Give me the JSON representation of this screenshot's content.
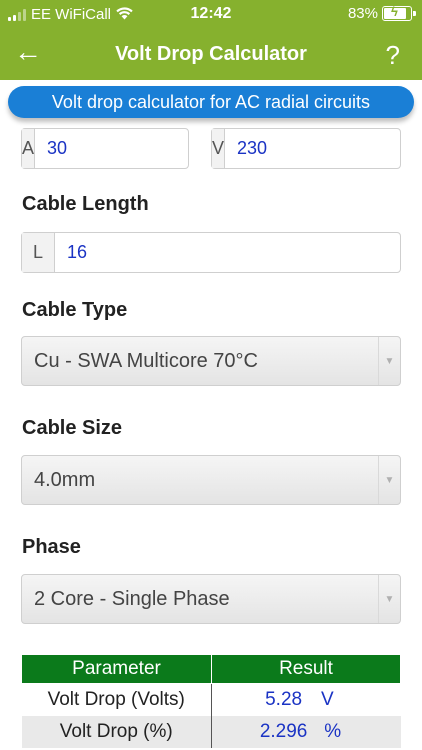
{
  "status": {
    "carrier": "EE WiFiCall",
    "time": "12:42",
    "battery_percent": "83%",
    "battery_level": 0.83
  },
  "nav": {
    "back_icon": "←",
    "title": "Volt Drop Calculator",
    "help_icon": "?"
  },
  "banner": "Volt drop calculator for AC radial circuits",
  "inputs": {
    "current": {
      "addon": "A",
      "value": "30"
    },
    "voltage": {
      "addon": "V",
      "value": "230"
    },
    "length": {
      "addon": "L",
      "value": "16"
    }
  },
  "labels": {
    "cable_length": "Cable Length",
    "cable_type": "Cable Type",
    "cable_size": "Cable Size",
    "phase": "Phase"
  },
  "selects": {
    "cable_type": "Cu - SWA Multicore 70°C",
    "cable_size": "4.0mm",
    "phase": "2 Core - Single Phase"
  },
  "results": {
    "headers": [
      "Parameter",
      "Result"
    ],
    "rows": [
      {
        "parameter": "Volt Drop (Volts)",
        "value": "5.28",
        "unit": "V"
      },
      {
        "parameter": "Volt Drop (%)",
        "value": "2.296",
        "unit": "%"
      }
    ]
  },
  "colors": {
    "header_green": "#86b12e",
    "banner_blue": "#1a7fd6",
    "table_green": "#0b7a1b",
    "value_blue": "#1a33c4"
  }
}
